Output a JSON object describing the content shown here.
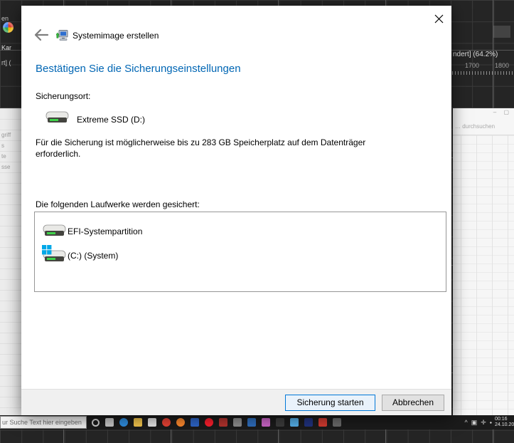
{
  "dialog": {
    "title": "Systemimage erstellen",
    "heading": "Bestätigen Sie die Sicherungseinstellungen",
    "location_label": "Sicherungsort:",
    "location_value": "Extreme SSD (D:)",
    "note_lines": [
      "Für die Sicherung ist möglicherweise bis zu 283 GB Speicherplatz auf dem Datenträger",
      "erforderlich."
    ],
    "drives_label": "Die folgenden Laufwerke werden gesichert:",
    "drives": [
      {
        "name": "EFI-Systempartition"
      },
      {
        "name": "(C:) (System)"
      }
    ],
    "start_button": "Sicherung starten",
    "cancel_button": "Abbrechen"
  },
  "colors": {
    "heading_blue": "#0066b4",
    "focus_border": "#0078d7",
    "drive_led_green": "#3fd24a",
    "windows_logo_blue": "#00a8e8"
  },
  "background": {
    "editor_title_fragment": "ndert] (64.2%)",
    "ruler_labels": [
      "1700",
      "1800"
    ],
    "right_window_search": "… durchsuchen",
    "right_window_controls": "– ▢",
    "left_fragments": [
      "en",
      "Kar",
      "rt] ("
    ],
    "left_panel_fragments": [
      "griff",
      "s",
      "te",
      "sse"
    ],
    "taskbar": {
      "search_text": "ur Suche Text hier eingeben",
      "tray_chevron": "^",
      "tray_glyphs": [
        "▣",
        "✛",
        "⬩"
      ],
      "clock_time": "00:16",
      "clock_date": "24.10.20",
      "icons": [
        {
          "name": "cortana-icon",
          "color": "#d0d0d0",
          "shape": "ring"
        },
        {
          "name": "taskview-icon",
          "color": "#c8c8c8"
        },
        {
          "name": "edge-icon",
          "color": "#2f8ee0",
          "shape": "round"
        },
        {
          "name": "explorer-icon",
          "color": "#f3c54c"
        },
        {
          "name": "photos-icon",
          "color": "#e6e6e6"
        },
        {
          "name": "chrome-icon",
          "color": "#ea4335",
          "shape": "round"
        },
        {
          "name": "firefox-icon",
          "color": "#ff8a2e",
          "shape": "round"
        },
        {
          "name": "app-blue-icon",
          "color": "#2e66c9"
        },
        {
          "name": "opera-icon",
          "color": "#ff1f2d",
          "shape": "round"
        },
        {
          "name": "app-darkred-icon",
          "color": "#b5342e"
        },
        {
          "name": "app-gray-icon",
          "color": "#8e8e8e"
        },
        {
          "name": "app-steelblue-icon",
          "color": "#2f6fbe"
        },
        {
          "name": "app-pink-icon",
          "color": "#cd66c9"
        },
        {
          "name": "app-dark-icon",
          "color": "#3c3c3c"
        },
        {
          "name": "app-lightblue-icon",
          "color": "#55b0ea"
        },
        {
          "name": "app-navy-icon",
          "color": "#20327e"
        },
        {
          "name": "app-red-icon",
          "color": "#d23b30"
        },
        {
          "name": "app-slate-icon",
          "color": "#6b6b6b"
        }
      ]
    }
  }
}
